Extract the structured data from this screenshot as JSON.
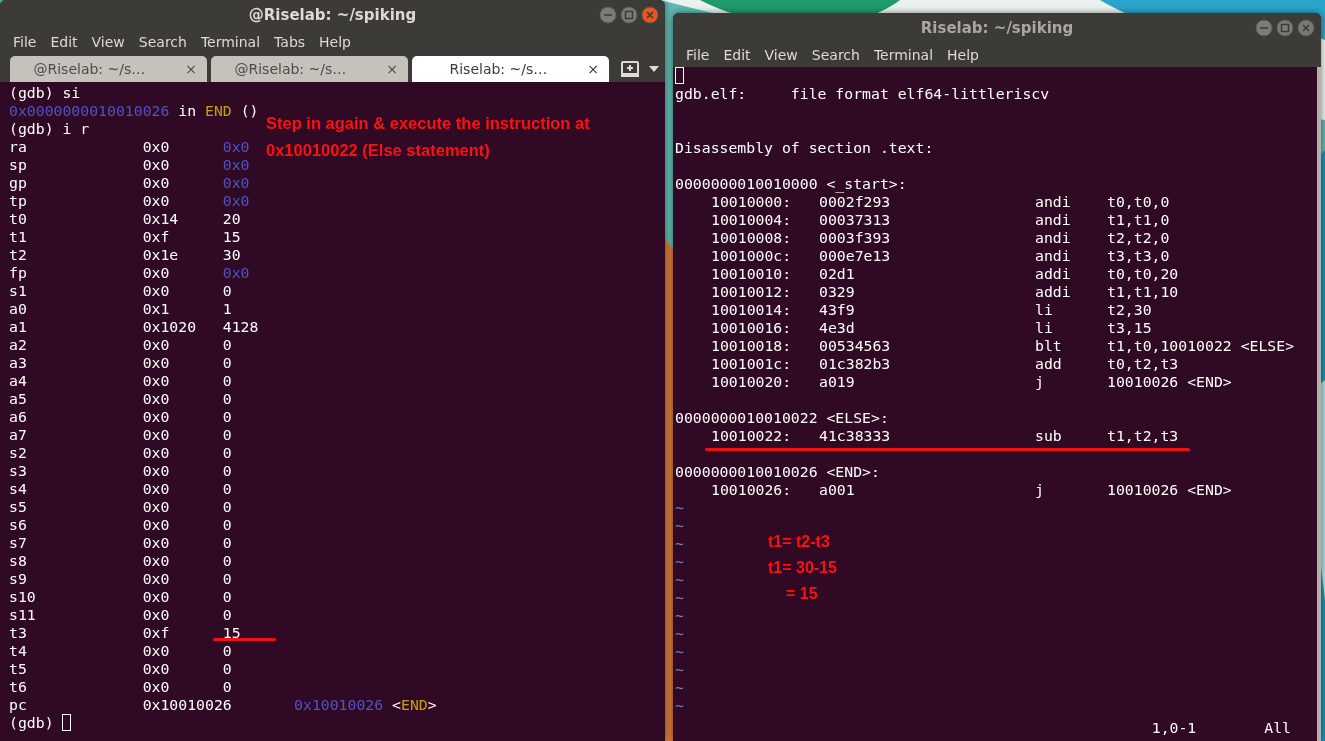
{
  "left_window": {
    "title": "@Riselab: ~/spiking",
    "active": true,
    "menu": [
      "File",
      "Edit",
      "View",
      "Search",
      "Terminal",
      "Tabs",
      "Help"
    ],
    "tabs": [
      {
        "label": "@Riselab: ~/s…",
        "close": "×",
        "selected": false
      },
      {
        "label": "@Riselab: ~/s…",
        "close": "×",
        "selected": false
      },
      {
        "label": "Riselab: ~/s…",
        "close": "×",
        "selected": true
      }
    ],
    "terminal": {
      "lines": [
        {
          "kind": "text",
          "segments": [
            {
              "text": "(gdb) si",
              "kind": "text"
            }
          ]
        },
        {
          "kind": "text",
          "segments": [
            {
              "text": "0x0000000010010026",
              "kind": "address"
            },
            {
              "text": " in ",
              "kind": "text"
            },
            {
              "text": "END",
              "kind": "symbol"
            },
            {
              "text": " ()",
              "kind": "text"
            }
          ]
        },
        {
          "kind": "text",
          "segments": [
            {
              "text": "(gdb) i r",
              "kind": "text"
            }
          ]
        },
        {
          "kind": "address_register",
          "name": "ra",
          "hex": "0x0",
          "natural": "0x0"
        },
        {
          "kind": "address_register",
          "name": "sp",
          "hex": "0x0",
          "natural": "0x0"
        },
        {
          "kind": "address_register",
          "name": "gp",
          "hex": "0x0",
          "natural": "0x0"
        },
        {
          "kind": "address_register",
          "name": "tp",
          "hex": "0x0",
          "natural": "0x0"
        },
        {
          "kind": "register",
          "name": "t0",
          "hex": "0x14",
          "natural": "20"
        },
        {
          "kind": "register",
          "name": "t1",
          "hex": "0xf",
          "natural": "15"
        },
        {
          "kind": "register",
          "name": "t2",
          "hex": "0x1e",
          "natural": "30"
        },
        {
          "kind": "address_register",
          "name": "fp",
          "hex": "0x0",
          "natural": "0x0"
        },
        {
          "kind": "register",
          "name": "s1",
          "hex": "0x0",
          "natural": "0"
        },
        {
          "kind": "register",
          "name": "a0",
          "hex": "0x1",
          "natural": "1"
        },
        {
          "kind": "register",
          "name": "a1",
          "hex": "0x1020",
          "natural": "4128"
        },
        {
          "kind": "register",
          "name": "a2",
          "hex": "0x0",
          "natural": "0"
        },
        {
          "kind": "register",
          "name": "a3",
          "hex": "0x0",
          "natural": "0"
        },
        {
          "kind": "register",
          "name": "a4",
          "hex": "0x0",
          "natural": "0"
        },
        {
          "kind": "register",
          "name": "a5",
          "hex": "0x0",
          "natural": "0"
        },
        {
          "kind": "register",
          "name": "a6",
          "hex": "0x0",
          "natural": "0"
        },
        {
          "kind": "register",
          "name": "a7",
          "hex": "0x0",
          "natural": "0"
        },
        {
          "kind": "register",
          "name": "s2",
          "hex": "0x0",
          "natural": "0"
        },
        {
          "kind": "register",
          "name": "s3",
          "hex": "0x0",
          "natural": "0"
        },
        {
          "kind": "register",
          "name": "s4",
          "hex": "0x0",
          "natural": "0"
        },
        {
          "kind": "register",
          "name": "s5",
          "hex": "0x0",
          "natural": "0"
        },
        {
          "kind": "register",
          "name": "s6",
          "hex": "0x0",
          "natural": "0"
        },
        {
          "kind": "register",
          "name": "s7",
          "hex": "0x0",
          "natural": "0"
        },
        {
          "kind": "register",
          "name": "s8",
          "hex": "0x0",
          "natural": "0"
        },
        {
          "kind": "register",
          "name": "s9",
          "hex": "0x0",
          "natural": "0"
        },
        {
          "kind": "register",
          "name": "s10",
          "hex": "0x0",
          "natural": "0"
        },
        {
          "kind": "register",
          "name": "s11",
          "hex": "0x0",
          "natural": "0"
        },
        {
          "kind": "register",
          "name": "t3",
          "hex": "0xf",
          "natural": "15"
        },
        {
          "kind": "register",
          "name": "t4",
          "hex": "0x0",
          "natural": "0"
        },
        {
          "kind": "register",
          "name": "t5",
          "hex": "0x0",
          "natural": "0"
        },
        {
          "kind": "register",
          "name": "t6",
          "hex": "0x0",
          "natural": "0"
        },
        {
          "kind": "pointer",
          "name": "pc",
          "hex": "0x10010026",
          "segments": [
            {
              "text": "0x10010026",
              "kind": "address"
            },
            {
              "text": " <",
              "kind": "text"
            },
            {
              "text": "END",
              "kind": "symbol"
            },
            {
              "text": ">",
              "kind": "text"
            }
          ]
        },
        {
          "kind": "prompt",
          "text": "(gdb)"
        }
      ],
      "annotation": [
        "Step in again & execute the instruction at",
        "0x10010022 (Else statement)"
      ]
    }
  },
  "right_window": {
    "title": "Riselab: ~/spiking",
    "active": false,
    "menu": [
      "File",
      "Edit",
      "View",
      "Search",
      "Terminal",
      "Help"
    ],
    "terminal": {
      "lines": [
        {
          "kind": "cursor"
        },
        {
          "kind": "text",
          "text": "gdb.elf:     file format elf64-littleriscv"
        },
        {
          "kind": "blank"
        },
        {
          "kind": "blank"
        },
        {
          "kind": "text",
          "text": "Disassembly of section .text:"
        },
        {
          "kind": "blank"
        },
        {
          "kind": "text",
          "text": "0000000010010000 <_start>:"
        },
        {
          "kind": "instr",
          "address": "10010000:",
          "code": "0002f293",
          "mnemonic": "andi",
          "operands": "t0,t0,0"
        },
        {
          "kind": "instr",
          "address": "10010004:",
          "code": "00037313",
          "mnemonic": "andi",
          "operands": "t1,t1,0"
        },
        {
          "kind": "instr",
          "address": "10010008:",
          "code": "0003f393",
          "mnemonic": "andi",
          "operands": "t2,t2,0"
        },
        {
          "kind": "instr",
          "address": "1001000c:",
          "code": "000e7e13",
          "mnemonic": "andi",
          "operands": "t3,t3,0"
        },
        {
          "kind": "instr",
          "address": "10010010:",
          "code": "02d1",
          "mnemonic": "addi",
          "operands": "t0,t0,20"
        },
        {
          "kind": "instr",
          "address": "10010012:",
          "code": "0329",
          "mnemonic": "addi",
          "operands": "t1,t1,10"
        },
        {
          "kind": "instr",
          "address": "10010014:",
          "code": "43f9",
          "mnemonic": "li",
          "operands": "t2,30"
        },
        {
          "kind": "instr",
          "address": "10010016:",
          "code": "4e3d",
          "mnemonic": "li",
          "operands": "t3,15"
        },
        {
          "kind": "instr",
          "address": "10010018:",
          "code": "00534563",
          "mnemonic": "blt",
          "operands": "t1,t0,10010022 <ELSE>"
        },
        {
          "kind": "instr",
          "address": "1001001c:",
          "code": "01c382b3",
          "mnemonic": "add",
          "operands": "t0,t2,t3"
        },
        {
          "kind": "instr",
          "address": "10010020:",
          "code": "a019",
          "mnemonic": "j",
          "operands": "10010026 <END>"
        },
        {
          "kind": "blank"
        },
        {
          "kind": "text",
          "text": "0000000010010022 <ELSE>:"
        },
        {
          "kind": "instr",
          "address": "10010022:",
          "code": "41c38333",
          "mnemonic": "sub",
          "operands": "t1,t2,t3"
        },
        {
          "kind": "blank"
        },
        {
          "kind": "text",
          "text": "0000000010010026 <END>:"
        },
        {
          "kind": "instr",
          "address": "10010026:",
          "code": "a001",
          "mnemonic": "j",
          "operands": "10010026 <END>"
        },
        {
          "kind": "tilde",
          "text": "~"
        },
        {
          "kind": "tilde",
          "text": "~"
        },
        {
          "kind": "tilde",
          "text": "~"
        },
        {
          "kind": "tilde",
          "text": "~"
        },
        {
          "kind": "tilde",
          "text": "~"
        },
        {
          "kind": "tilde",
          "text": "~"
        },
        {
          "kind": "tilde",
          "text": "~"
        },
        {
          "kind": "tilde",
          "text": "~"
        },
        {
          "kind": "tilde",
          "text": "~"
        },
        {
          "kind": "tilde",
          "text": "~"
        },
        {
          "kind": "tilde",
          "text": "~"
        },
        {
          "kind": "tilde",
          "text": "~"
        }
      ],
      "status": {
        "position": "1,0-1",
        "scroll": "All"
      },
      "annotation": [
        "t1= t2-t3",
        "t1= 30-15",
        "= 15"
      ]
    }
  }
}
